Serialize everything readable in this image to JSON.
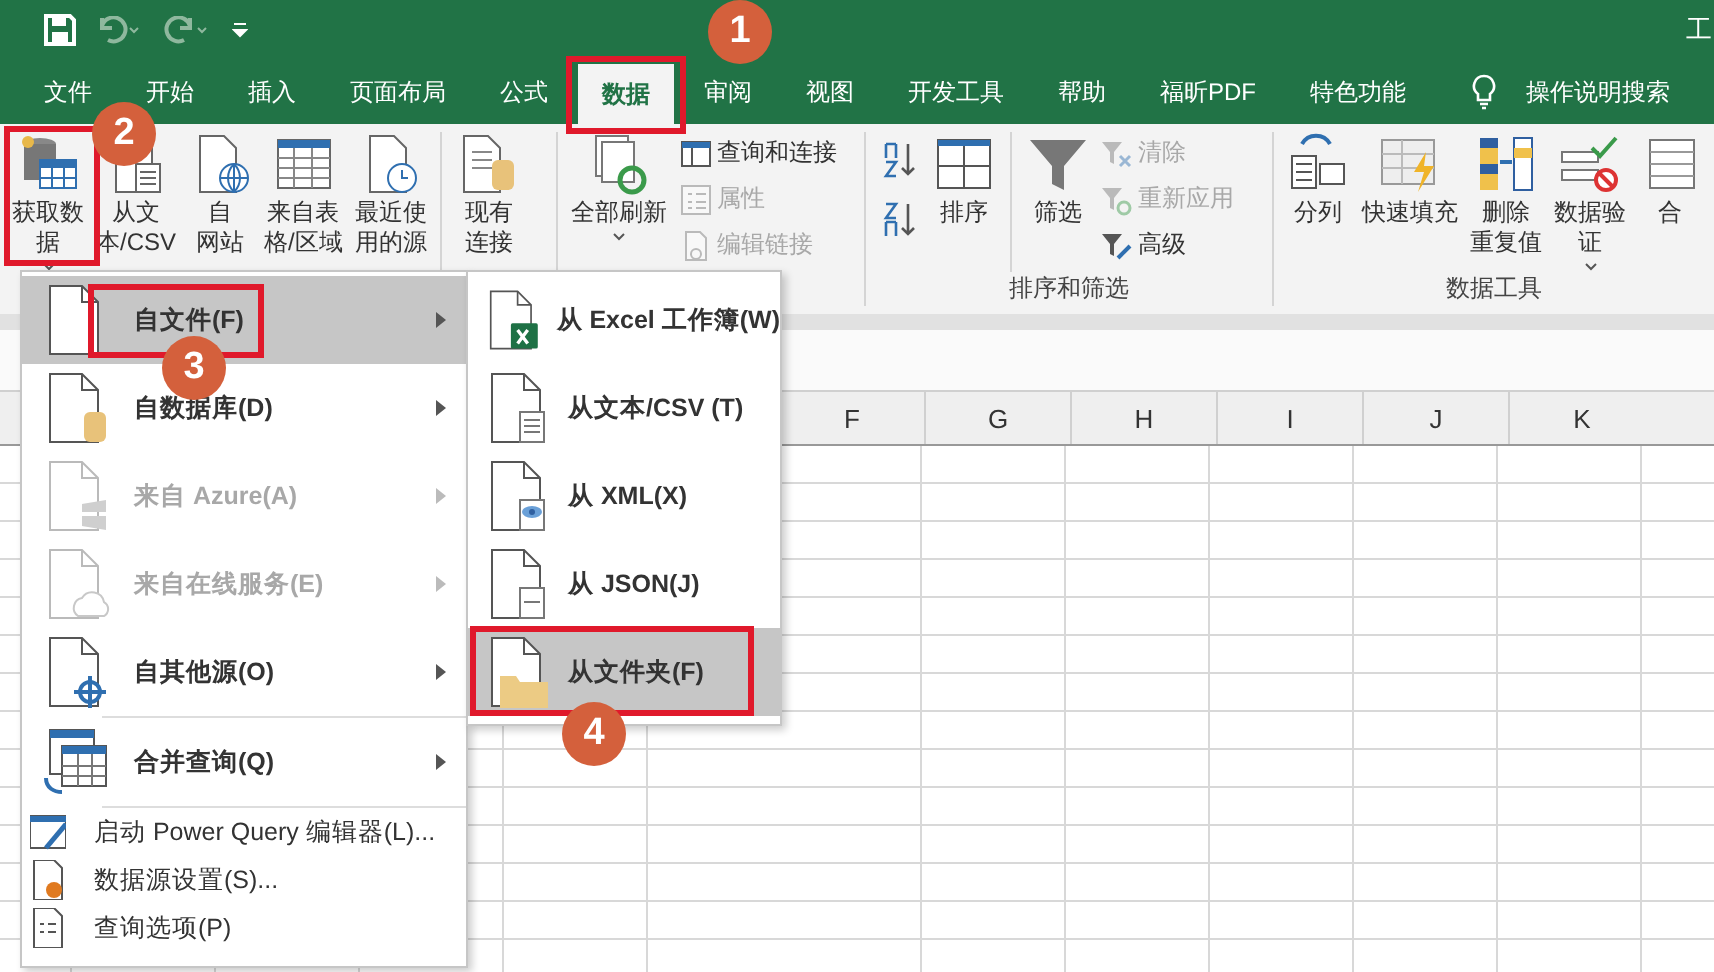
{
  "title_bar": {
    "title": "工"
  },
  "tabs": [
    {
      "label": "文件",
      "selected": false
    },
    {
      "label": "开始",
      "selected": false
    },
    {
      "label": "插入",
      "selected": false
    },
    {
      "label": "页面布局",
      "selected": false
    },
    {
      "label": "公式",
      "selected": false
    },
    {
      "label": "数据",
      "selected": true
    },
    {
      "label": "审阅",
      "selected": false
    },
    {
      "label": "视图",
      "selected": false
    },
    {
      "label": "开发工具",
      "selected": false
    },
    {
      "label": "帮助",
      "selected": false
    },
    {
      "label": "福昕PDF",
      "selected": false
    },
    {
      "label": "特色功能",
      "selected": false
    }
  ],
  "tell_me": {
    "label": "操作说明搜索"
  },
  "ribbon": {
    "get_data": [
      {
        "lines": [
          "获取数",
          "据"
        ],
        "dropdown": true
      },
      {
        "lines": [
          "从文",
          "本/CSV"
        ],
        "dropdown": false
      },
      {
        "lines": [
          "自",
          "网站"
        ],
        "dropdown": false
      },
      {
        "lines": [
          "来自表",
          "格/区域"
        ],
        "dropdown": false
      },
      {
        "lines": [
          "最近使",
          "用的源"
        ],
        "dropdown": false
      }
    ],
    "connections": {
      "lines": [
        "现有",
        "连接"
      ],
      "dropdown": false
    },
    "refresh": {
      "lines": [
        "全部刷新"
      ],
      "dropdown": true
    },
    "queries": [
      {
        "label": "查询和连接",
        "disabled": false
      },
      {
        "label": "属性",
        "disabled": true
      },
      {
        "label": "编辑链接",
        "disabled": true
      }
    ],
    "sort_filter": {
      "sort": "排序",
      "filter": "筛选",
      "small": [
        {
          "label": "清除",
          "disabled": true
        },
        {
          "label": "重新应用",
          "disabled": true
        },
        {
          "label": "高级",
          "disabled": false
        }
      ],
      "group_label": "排序和筛选"
    },
    "data_tools": {
      "buttons": [
        {
          "lines": [
            "分列"
          ],
          "dropdown": false
        },
        {
          "lines": [
            "快速填充"
          ],
          "dropdown": false
        },
        {
          "lines": [
            "删除",
            "重复值"
          ],
          "dropdown": false
        },
        {
          "lines": [
            "数据验",
            "证"
          ],
          "dropdown": true
        },
        {
          "lines": [
            "合"
          ],
          "dropdown": false
        }
      ],
      "group_label": "数据工具"
    }
  },
  "menu": {
    "items": [
      {
        "kind": "large",
        "label": "自文件(F)",
        "selected": true,
        "disabled": false,
        "submenu": true
      },
      {
        "kind": "large",
        "label": "自数据库(D)",
        "selected": false,
        "disabled": false,
        "submenu": true
      },
      {
        "kind": "large",
        "label": "来自 Azure(A)",
        "selected": false,
        "disabled": true,
        "submenu": true
      },
      {
        "kind": "large",
        "label": "来自在线服务(E)",
        "selected": false,
        "disabled": true,
        "submenu": true
      },
      {
        "kind": "large",
        "label": "自其他源(O)",
        "selected": false,
        "disabled": false,
        "submenu": true
      },
      {
        "kind": "large",
        "label": "合并查询(Q)",
        "selected": false,
        "disabled": false,
        "submenu": true
      },
      {
        "kind": "small",
        "label": "启动 Power Query 编辑器(L)...",
        "selected": false,
        "disabled": false,
        "submenu": false
      },
      {
        "kind": "small",
        "label": "数据源设置(S)...",
        "selected": false,
        "disabled": false,
        "submenu": false
      },
      {
        "kind": "small",
        "label": "查询选项(P)",
        "selected": false,
        "disabled": false,
        "submenu": false
      }
    ]
  },
  "submenu": {
    "items": [
      {
        "label": "从 Excel 工作簿(W)",
        "selected": false
      },
      {
        "label": "从文本/CSV (T)",
        "selected": false
      },
      {
        "label": "从 XML(X)",
        "selected": false
      },
      {
        "label": "从 JSON(J)",
        "selected": false
      },
      {
        "label": "从文件夹(F)",
        "selected": true
      }
    ]
  },
  "columns": [
    "F",
    "G",
    "H",
    "I",
    "J",
    "K"
  ],
  "annotations": [
    {
      "number": "1"
    },
    {
      "number": "2"
    },
    {
      "number": "3"
    },
    {
      "number": "4"
    }
  ]
}
